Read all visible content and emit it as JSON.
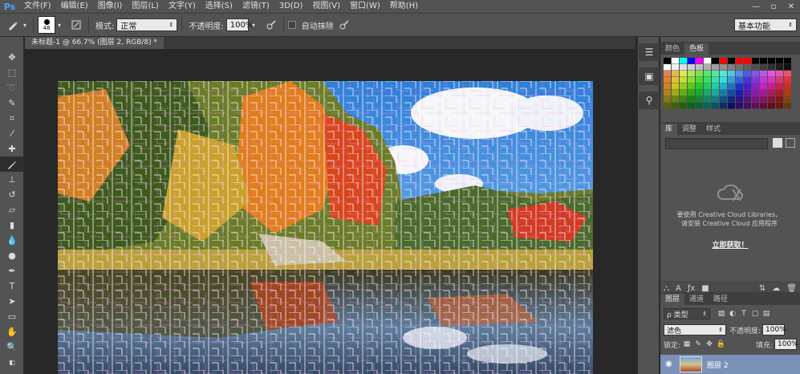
{
  "app": {
    "logo": "Ps"
  },
  "menu": [
    "文件(F)",
    "编辑(E)",
    "图像(I)",
    "图层(L)",
    "文字(Y)",
    "选择(S)",
    "滤镜(T)",
    "3D(D)",
    "视图(V)",
    "窗口(W)",
    "帮助(H)"
  ],
  "window_controls": [
    "—",
    "▫",
    "✕"
  ],
  "options": {
    "brush_size": "48",
    "mode_label": "模式:",
    "mode_value": "正常",
    "opacity_label": "不透明度:",
    "opacity_value": "100%",
    "auto_erase_label": "自动抹除",
    "workspace_value": "基本功能"
  },
  "document": {
    "tab_title": "未标题-1 @ 66.7% (图层 2, RGB/8) *"
  },
  "swatches_panel": {
    "tabs": [
      "颜色",
      "色板"
    ],
    "active_tab": 1
  },
  "libraries_panel": {
    "tabs": [
      "库",
      "调整",
      "样式"
    ],
    "message_line1": "要使用 Creative Cloud Libraries，",
    "message_line2": "请安装 Creative Cloud 应用程序",
    "link_text": "立即获取！"
  },
  "layers_panel": {
    "tabs": [
      "图层",
      "通道",
      "路径"
    ],
    "filter_label": "ρ 类型",
    "blend_mode": "滤色",
    "opacity_label": "不透明度:",
    "opacity_value": "100%",
    "lock_label": "锁定:",
    "fill_label": "填充:",
    "fill_value": "100%",
    "layer_name": "图层 2"
  },
  "colors": {
    "ui_dark": "#535353",
    "selection_blue": "#7b92b8",
    "accent_blue": "#4aa4ff"
  }
}
